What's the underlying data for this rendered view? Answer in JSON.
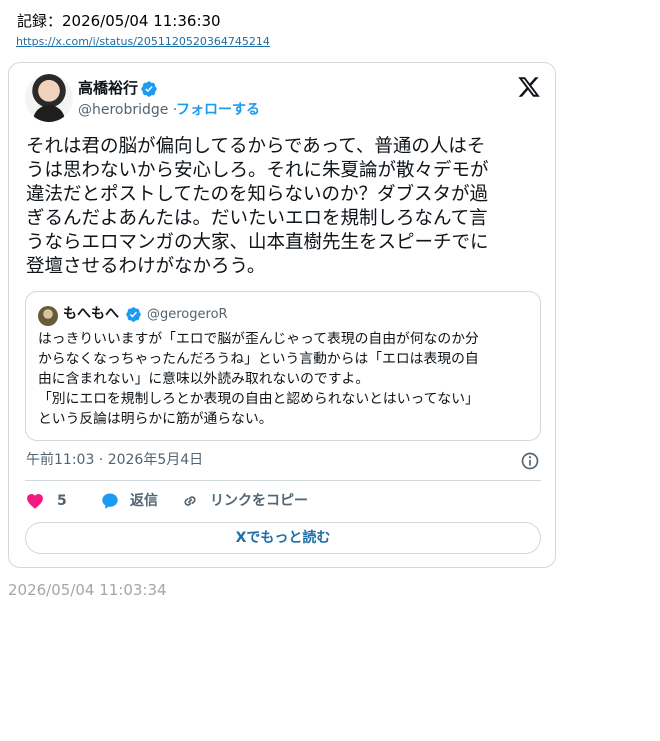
{
  "record": "記録：2026/05/04 11:36:30",
  "source_url": "https://x.com/i/status/2051120520364745214",
  "tweet": {
    "author_name": "高橋裕行",
    "author_handle": "@herobridge",
    "separator": "·",
    "follow_label": "フォローする",
    "text": "それは君の脳が偏向してるからであって、普通の人はそ\nうは思わないから安心しろ。それに朱夏論が散々デモが\n違法だとポストしてたのを知らないのか？ダブスタが過\nぎるんだよあんたは。だいたいエロを規制しろなんて言\nうならエロマンガの大家、山本直樹先生をスピーチでに\n登壇させるわけがなかろう。",
    "quote": {
      "author_name": "もへもへ",
      "author_handle": "@gerogeroR",
      "text": "はっきりいいますが「エロで脳が歪んじゃって表現の自由が何なのか分\nからなくなっちゃったんだろうね」という言動からは「エロは表現の自\n由に含まれない」に意味以外読み取れないのですよ。\n「別にエロを規制しろとか表現の自由と認められないとはいってない」\nという反論は明らかに筋が通らない。"
    },
    "timestamp": "午前11:03 · 2026年5月4日",
    "like_count": "5",
    "reply_label": "返信",
    "copy_link_label": "リンクをコピー",
    "read_more_label": "Xでもっと読む"
  },
  "footer_time": "2026/05/04 11:03:34",
  "colors": {
    "accent": "#1d9bf0",
    "like": "#f91880",
    "link": "#1d6fa5",
    "muted": "#536471",
    "border": "#cfd9de"
  },
  "icons": [
    "verified-badge-icon",
    "x-logo-icon",
    "info-icon",
    "heart-icon",
    "reply-bubble-icon",
    "link-icon"
  ]
}
